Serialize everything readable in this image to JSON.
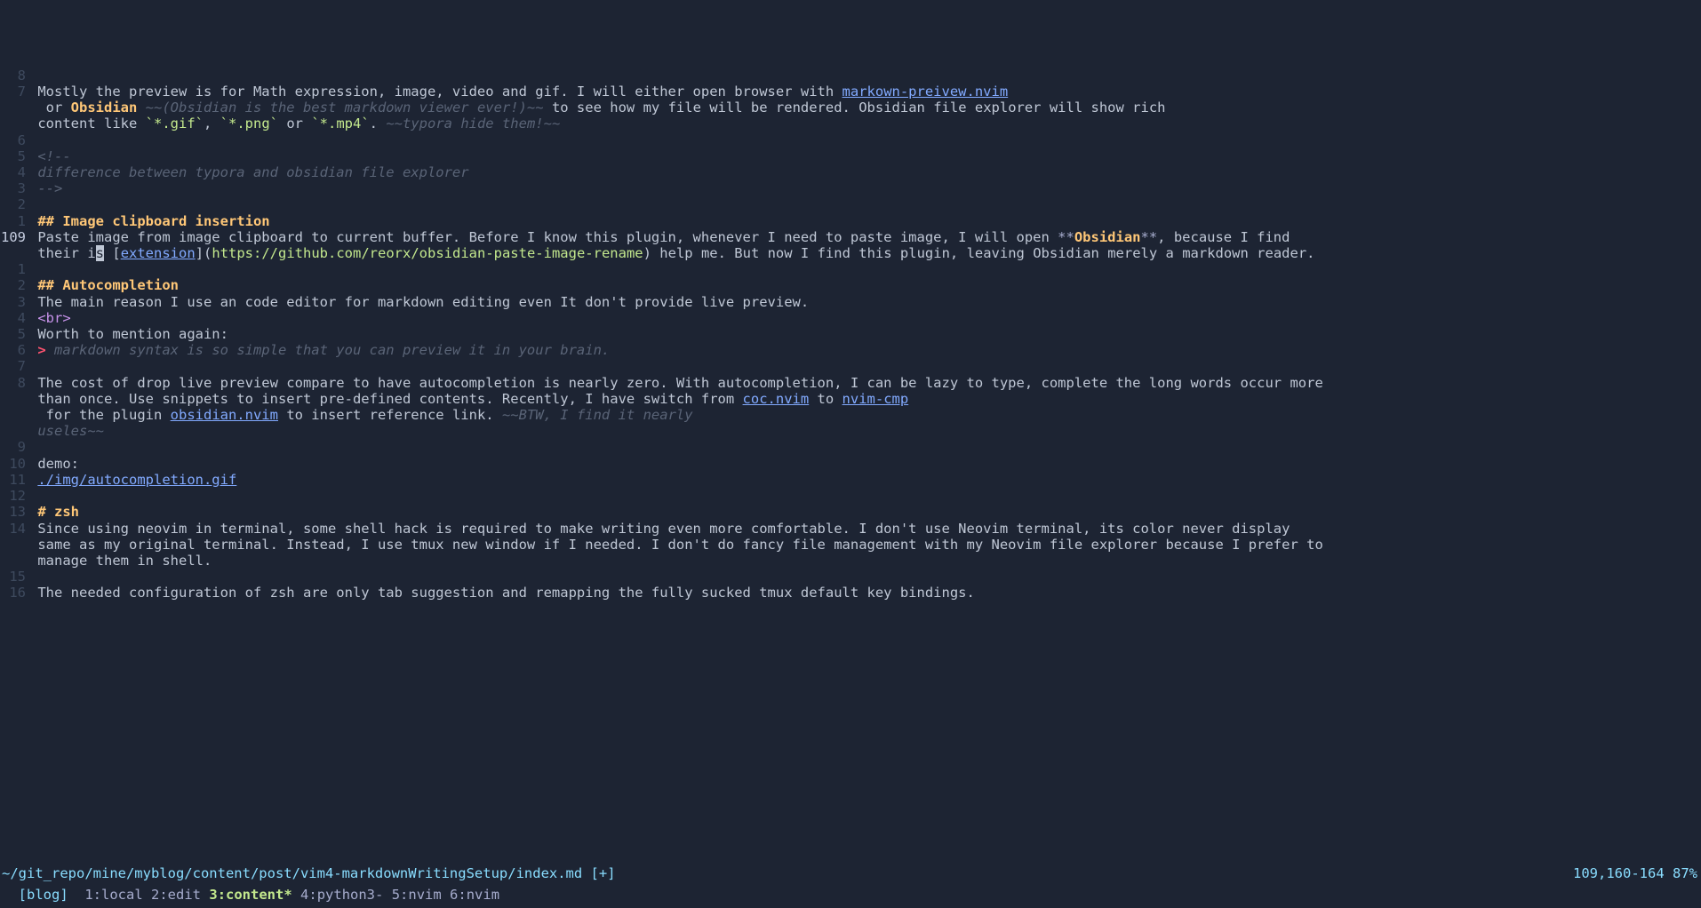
{
  "lines": [
    {
      "num": "8",
      "current": false,
      "segs": []
    },
    {
      "num": "7",
      "current": false,
      "segs": [
        {
          "t": "Mostly the preview is for Math expression, image, video and gif. I will either open browser with ",
          "c": "text"
        },
        {
          "t": "markown-preivew.nvim",
          "c": "link"
        }
      ]
    },
    {
      "num": "",
      "current": false,
      "segs": [
        {
          "t": " or ",
          "c": "text"
        },
        {
          "t": "Obsidian",
          "c": "orange"
        },
        {
          "t": " ",
          "c": "text"
        },
        {
          "t": "~~(Obsidian is the best markdown viewer ever!)~~",
          "c": "strike"
        },
        {
          "t": " to see how my file will be rendered. Obsidian file explorer will show rich",
          "c": "text"
        }
      ]
    },
    {
      "num": "",
      "current": false,
      "segs": [
        {
          "t": "content like ",
          "c": "text"
        },
        {
          "t": "`*.gif`",
          "c": "code"
        },
        {
          "t": ", ",
          "c": "text"
        },
        {
          "t": "`*.png`",
          "c": "code"
        },
        {
          "t": " or ",
          "c": "text"
        },
        {
          "t": "`*.mp4`",
          "c": "code"
        },
        {
          "t": ". ",
          "c": "text"
        },
        {
          "t": "~~typora hide them!~~",
          "c": "strike"
        }
      ]
    },
    {
      "num": "6",
      "current": false,
      "segs": []
    },
    {
      "num": "5",
      "current": false,
      "segs": [
        {
          "t": "<!--",
          "c": "dim"
        }
      ]
    },
    {
      "num": "4",
      "current": false,
      "segs": [
        {
          "t": "difference between typora and obsidian file explorer",
          "c": "dim"
        }
      ]
    },
    {
      "num": "3",
      "current": false,
      "segs": [
        {
          "t": "-->",
          "c": "dim"
        }
      ]
    },
    {
      "num": "2",
      "current": false,
      "segs": []
    },
    {
      "num": "1",
      "current": false,
      "segs": [
        {
          "t": "## Image clipboard insertion",
          "c": "header"
        }
      ]
    },
    {
      "num": "109",
      "current": true,
      "segs": [
        {
          "t": "Paste image from image clipboard to current buffer. Before I know this plugin, whenever I need to paste image, I will open ",
          "c": "text"
        },
        {
          "t": "**",
          "c": "bold-marker"
        },
        {
          "t": "Obsidian",
          "c": "orange"
        },
        {
          "t": "**",
          "c": "bold-marker"
        },
        {
          "t": ", because I find",
          "c": "text"
        }
      ]
    },
    {
      "num": "",
      "current": false,
      "segs": [
        {
          "t": "their i",
          "c": "text"
        },
        {
          "t": "s",
          "c": "cursor-bg"
        },
        {
          "t": " [",
          "c": "text"
        },
        {
          "t": "extension",
          "c": "link"
        },
        {
          "t": "](",
          "c": "text"
        },
        {
          "t": "https://github.com/reorx/obsidian-paste-image-rename",
          "c": "url"
        },
        {
          "t": ") help me. But now I find this plugin, leaving Obsidian merely a markdown reader.",
          "c": "text"
        }
      ]
    },
    {
      "num": "1",
      "current": false,
      "segs": []
    },
    {
      "num": "2",
      "current": false,
      "segs": [
        {
          "t": "## Autocompletion",
          "c": "header"
        }
      ]
    },
    {
      "num": "3",
      "current": false,
      "segs": [
        {
          "t": "The main reason I use an code editor for markdown editing even It don't provide live preview.",
          "c": "text"
        }
      ]
    },
    {
      "num": "4",
      "current": false,
      "segs": [
        {
          "t": "<br>",
          "c": "tag"
        }
      ]
    },
    {
      "num": "5",
      "current": false,
      "segs": [
        {
          "t": "Worth to mention again:",
          "c": "text"
        }
      ]
    },
    {
      "num": "6",
      "current": false,
      "segs": [
        {
          "t": "> ",
          "c": "quote-marker"
        },
        {
          "t": "markdown syntax is so simple that you can preview it in your brain.",
          "c": "quote"
        }
      ]
    },
    {
      "num": "7",
      "current": false,
      "segs": []
    },
    {
      "num": "8",
      "current": false,
      "segs": [
        {
          "t": "The cost of drop live preview compare to have autocompletion is nearly zero. With autocompletion, I can be lazy to type, complete the long words occur more",
          "c": "text"
        }
      ]
    },
    {
      "num": "",
      "current": false,
      "segs": [
        {
          "t": "than once. Use snippets to insert pre-defined contents. Recently, I have switch from ",
          "c": "text"
        },
        {
          "t": "coc.nvim",
          "c": "link"
        },
        {
          "t": " to ",
          "c": "text"
        },
        {
          "t": "nvim-cmp",
          "c": "link"
        }
      ]
    },
    {
      "num": "",
      "current": false,
      "segs": [
        {
          "t": " for the plugin ",
          "c": "text"
        },
        {
          "t": "obsidian.nvim",
          "c": "link"
        },
        {
          "t": " to insert reference link. ",
          "c": "text"
        },
        {
          "t": "~~BTW, I find it nearly",
          "c": "strike"
        }
      ]
    },
    {
      "num": "",
      "current": false,
      "segs": [
        {
          "t": "useles~~",
          "c": "strike"
        }
      ]
    },
    {
      "num": "9",
      "current": false,
      "segs": []
    },
    {
      "num": "10",
      "current": false,
      "segs": [
        {
          "t": "demo:",
          "c": "text"
        }
      ]
    },
    {
      "num": "11",
      "current": false,
      "segs": [
        {
          "t": "./img/autocompletion.gif",
          "c": "link"
        }
      ]
    },
    {
      "num": "12",
      "current": false,
      "segs": []
    },
    {
      "num": "13",
      "current": false,
      "segs": [
        {
          "t": "# zsh",
          "c": "header"
        }
      ]
    },
    {
      "num": "14",
      "current": false,
      "segs": [
        {
          "t": "Since using neovim in terminal, some shell hack is required to make writing even more comfortable. I don't use Neovim terminal, its color never display",
          "c": "text"
        }
      ]
    },
    {
      "num": "",
      "current": false,
      "segs": [
        {
          "t": "same as my original terminal. Instead, I use tmux new window if I needed. I don't do fancy file management with my Neovim file explorer because I prefer to",
          "c": "text"
        }
      ]
    },
    {
      "num": "",
      "current": false,
      "segs": [
        {
          "t": "manage them in shell.",
          "c": "text"
        }
      ]
    },
    {
      "num": "15",
      "current": false,
      "segs": []
    },
    {
      "num": "16",
      "current": false,
      "segs": [
        {
          "t": "The needed configuration of zsh are only tab suggestion and remapping the fully sucked tmux default key bindings.",
          "c": "text"
        }
      ]
    }
  ],
  "filebar": {
    "path": "~/git_repo/mine/myblog/content/post/vim4-markdownWritingSetup/index.md [+]",
    "pos": "109,160-164 87%"
  },
  "tmux": {
    "session": "[blog]",
    "windows": [
      {
        "label": "1:local",
        "active": false
      },
      {
        "label": "2:edit",
        "active": false
      },
      {
        "label": "3:content*",
        "active": true
      },
      {
        "label": "4:python3-",
        "active": false
      },
      {
        "label": "5:nvim",
        "active": false
      },
      {
        "label": "6:nvim",
        "active": false
      }
    ]
  }
}
